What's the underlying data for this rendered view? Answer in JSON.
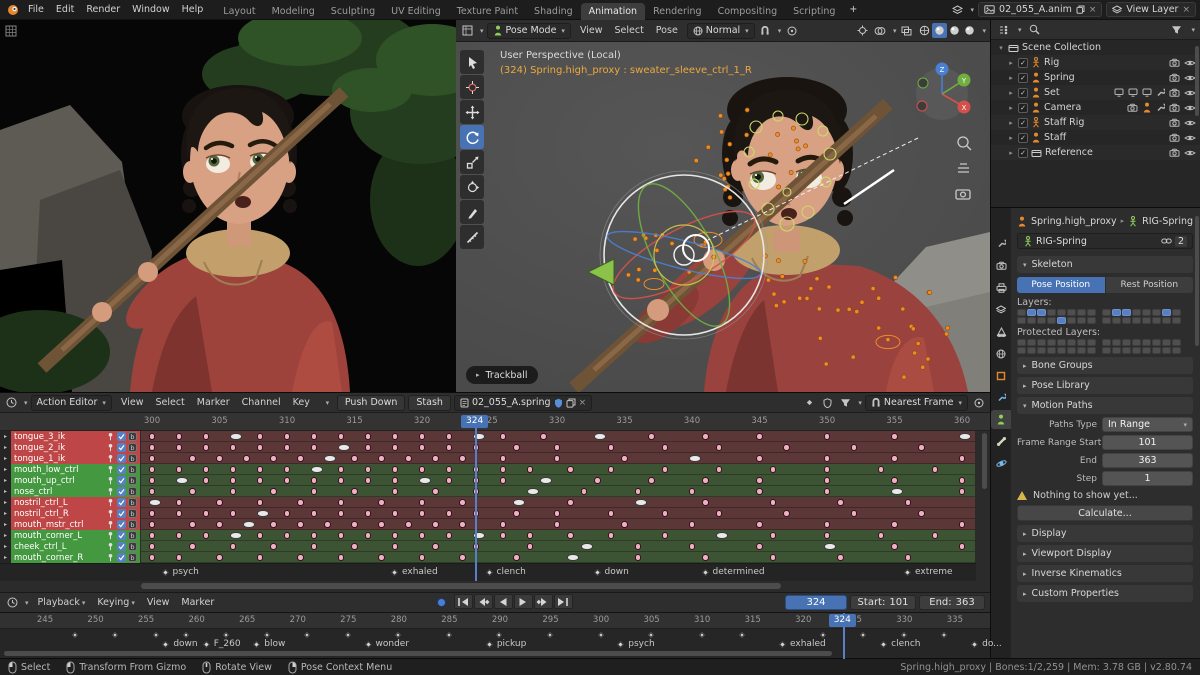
{
  "topbar": {
    "menus": [
      "File",
      "Edit",
      "Render",
      "Window",
      "Help"
    ],
    "workspaces": [
      "Layout",
      "Modeling",
      "Sculpting",
      "UV Editing",
      "Texture Paint",
      "Shading",
      "Animation",
      "Rendering",
      "Compositing",
      "Scripting"
    ],
    "active_workspace": "Animation",
    "add_tab": "+",
    "scene_name": "02_055_A.anim",
    "view_layer_name": "View Layer"
  },
  "viewport": {
    "mode": "Pose Mode",
    "menus": [
      "View",
      "Select",
      "Pose"
    ],
    "orientation": "Normal",
    "overlay_line1": "User Perspective (Local)",
    "overlay_line2": "(324) Spring.high_proxy : sweater_sleeve_ctrl_1_R",
    "hint_label": "Trackball",
    "tools": [
      "select-box",
      "cursor",
      "move",
      "rotate",
      "scale",
      "transform",
      "annotate",
      "measure"
    ],
    "active_tool": "rotate",
    "shading_modes": [
      "wireframe",
      "solid",
      "material-preview",
      "rendered"
    ],
    "active_shading": "solid"
  },
  "outliner": {
    "root": "Scene Collection",
    "items": [
      {
        "name": "Rig",
        "icon": "armature",
        "extras": []
      },
      {
        "name": "Spring",
        "icon": "person",
        "extras": []
      },
      {
        "name": "Set",
        "icon": "person",
        "extras": [
          "screen",
          "screen",
          "screen",
          "wrench"
        ]
      },
      {
        "name": "Camera",
        "icon": "person",
        "extras": [
          "camera",
          "person",
          "wrench"
        ]
      },
      {
        "name": "Staff Rig",
        "icon": "armature",
        "extras": []
      },
      {
        "name": "Staff",
        "icon": "person",
        "extras": []
      },
      {
        "name": "Reference",
        "icon": "collection",
        "extras": []
      }
    ]
  },
  "properties_tabs": {
    "tabs": [
      "tool",
      "render",
      "output",
      "view-layer",
      "scene",
      "world",
      "object",
      "modifiers",
      "data",
      "bone",
      "physics"
    ],
    "active": "data"
  },
  "properties": {
    "breadcrumb_object": "Spring.high_proxy",
    "breadcrumb_data": "RIG-Spring",
    "datablock_name": "RIG-Spring",
    "datablock_users": "2",
    "skeleton_section": "Skeleton",
    "pose_position": "Pose Position",
    "rest_position": "Rest Position",
    "layers_label": "Layers:",
    "protected_layers_label": "Protected Layers:",
    "layers_on_row1": [
      1,
      2,
      9,
      10,
      14
    ],
    "layers_on_row2": [
      4
    ],
    "collapsed_sections_top": [
      "Bone Groups",
      "Pose Library"
    ],
    "motion_paths_section": "Motion Paths",
    "paths_type_label": "Paths Type",
    "paths_type_value": "In Range",
    "frame_range_start_label": "Frame Range Start",
    "frame_range_start_value": "101",
    "end_label": "End",
    "end_value": "363",
    "step_label": "Step",
    "step_value": "1",
    "warning_text": "Nothing to show yet...",
    "calculate_button": "Calculate...",
    "collapsed_sections_bottom": [
      "Display",
      "Viewport Display",
      "Inverse Kinematics",
      "Custom Properties"
    ]
  },
  "dopesheet": {
    "editor_mode": "Action Editor",
    "menus": [
      "View",
      "Select",
      "Marker",
      "Channel",
      "Key"
    ],
    "push_down_button": "Push Down",
    "stash_button": "Stash",
    "action_name": "02_055_A.spring",
    "snap_mode": "Nearest Frame",
    "ruler_frames": [
      300,
      305,
      310,
      315,
      320,
      325,
      330,
      335,
      340,
      345,
      350,
      355,
      360
    ],
    "current_frame": "324",
    "channels": [
      {
        "name": "tongue_3_ik",
        "group": "red",
        "keys": [
          300,
          302,
          304,
          306,
          308,
          310,
          312,
          314,
          316,
          318,
          320,
          322,
          324,
          326,
          329,
          333,
          337,
          341,
          345,
          350,
          355,
          360
        ]
      },
      {
        "name": "tongue_2_ik",
        "group": "red",
        "keys": [
          300,
          302,
          304,
          306,
          308,
          310,
          312,
          314,
          316,
          318,
          320,
          322,
          324,
          327,
          330,
          334,
          338,
          342,
          347,
          352,
          357,
          362
        ]
      },
      {
        "name": "tongue_1_ik",
        "group": "red",
        "keys": [
          300,
          303,
          305,
          307,
          309,
          311,
          313,
          315,
          317,
          319,
          321,
          323,
          326,
          330,
          335,
          340,
          345,
          350,
          355,
          360
        ]
      },
      {
        "name": "mouth_low_ctrl",
        "group": "green",
        "keys": [
          300,
          302,
          304,
          306,
          308,
          310,
          312,
          314,
          316,
          318,
          320,
          322,
          324,
          326,
          328,
          331,
          334,
          338,
          342,
          346,
          350,
          354,
          358,
          362
        ]
      },
      {
        "name": "mouth_up_ctrl",
        "group": "green",
        "keys": [
          300,
          302,
          304,
          306,
          308,
          310,
          312,
          314,
          316,
          318,
          320,
          322,
          324,
          326,
          329,
          333,
          337,
          341,
          345,
          350,
          355,
          360
        ]
      },
      {
        "name": "nose_ctrl",
        "group": "green",
        "keys": [
          300,
          303,
          306,
          309,
          312,
          315,
          318,
          321,
          324,
          328,
          332,
          336,
          340,
          345,
          350,
          355,
          360
        ]
      },
      {
        "name": "nostril_ctrl_L",
        "group": "red",
        "keys": [
          300,
          302,
          305,
          308,
          311,
          314,
          317,
          320,
          323,
          327,
          331,
          336,
          341,
          346,
          351,
          356,
          361
        ]
      },
      {
        "name": "nostril_ctrl_R",
        "group": "red",
        "keys": [
          300,
          302,
          304,
          306,
          308,
          310,
          312,
          314,
          316,
          318,
          320,
          322,
          324,
          327,
          330,
          334,
          338,
          342,
          347,
          352,
          357,
          362
        ]
      },
      {
        "name": "mouth_mstr_ctrl",
        "group": "red",
        "keys": [
          300,
          303,
          305,
          307,
          309,
          311,
          313,
          315,
          317,
          319,
          321,
          323,
          326,
          330,
          335,
          340,
          345,
          350,
          355,
          360
        ]
      },
      {
        "name": "mouth_corner_L",
        "group": "green",
        "keys": [
          300,
          302,
          304,
          306,
          308,
          310,
          312,
          314,
          316,
          318,
          320,
          322,
          324,
          326,
          328,
          331,
          334,
          338,
          342,
          346,
          350,
          354,
          358,
          362
        ]
      },
      {
        "name": "cheek_ctrl_L",
        "group": "green",
        "keys": [
          300,
          303,
          306,
          309,
          312,
          315,
          318,
          321,
          324,
          328,
          332,
          336,
          340,
          345,
          350,
          355,
          360
        ]
      },
      {
        "name": "mouth_corner_R",
        "group": "green",
        "keys": [
          300,
          302,
          305,
          308,
          311,
          314,
          317,
          320,
          323,
          327,
          331,
          336,
          341,
          346,
          351,
          356,
          361
        ]
      }
    ],
    "markers": [
      {
        "name": "psych",
        "frame": 301
      },
      {
        "name": "exhaled",
        "frame": 318
      },
      {
        "name": "clench",
        "frame": 325
      },
      {
        "name": "down",
        "frame": 333
      },
      {
        "name": "determined",
        "frame": 341
      },
      {
        "name": "extreme",
        "frame": 356
      }
    ]
  },
  "playback": {
    "menus": [
      "Playback",
      "Keying",
      "View",
      "Marker"
    ],
    "transport": [
      "jump-start",
      "prev-keyframe",
      "play-reverse",
      "play",
      "next-keyframe",
      "jump-end"
    ],
    "current_frame": "324",
    "start_label": "Start:",
    "start_value": "101",
    "end_label": "End:",
    "end_value": "363"
  },
  "timeline": {
    "ruler_frames": [
      245,
      250,
      255,
      260,
      265,
      270,
      275,
      280,
      285,
      290,
      295,
      300,
      305,
      310,
      315,
      320,
      325,
      330,
      335
    ],
    "current_frame": "324",
    "markers": [
      {
        "name": "down",
        "frame": 257
      },
      {
        "name": "F_260",
        "frame": 261
      },
      {
        "name": "blow",
        "frame": 266
      },
      {
        "name": "wonder",
        "frame": 277
      },
      {
        "name": "pickup",
        "frame": 289
      },
      {
        "name": "psych",
        "frame": 302
      },
      {
        "name": "exhaled",
        "frame": 318
      },
      {
        "name": "clench",
        "frame": 328
      },
      {
        "name": "do...",
        "frame": 337
      }
    ],
    "keyframes": [
      248,
      252,
      256,
      259,
      263,
      267,
      271,
      275,
      280,
      285,
      290,
      295,
      300,
      305,
      310,
      314,
      322,
      326,
      330,
      334
    ]
  },
  "statusbar": {
    "items": [
      {
        "label": "Select",
        "mouse": "left"
      },
      {
        "label": "Transform From Gizmo",
        "mouse": "left"
      },
      {
        "label": "Rotate View",
        "mouse": "middle"
      },
      {
        "label": "Pose Context Menu",
        "mouse": "right"
      }
    ],
    "info": "Spring.high_proxy | Bones:1/2,259 | Mem: 3.78 GB | v2.80.74"
  }
}
